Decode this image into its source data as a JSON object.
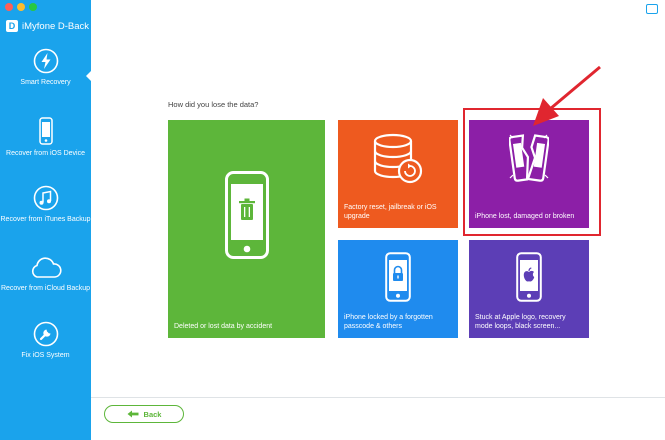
{
  "window": {
    "title": "iMyfone D-Back",
    "traffic_light_colors": [
      "#ff5f57",
      "#febc2e",
      "#28c840"
    ]
  },
  "sidebar": {
    "background": "#1aa3ec",
    "items": [
      {
        "label": "Smart Recovery",
        "icon": "lightning-icon",
        "active": true
      },
      {
        "label": "Recover from iOS Device",
        "icon": "iphone-icon",
        "active": false
      },
      {
        "label": "Recover from iTunes Backup",
        "icon": "music-note-icon",
        "active": false
      },
      {
        "label": "Recover from iCloud Backup",
        "icon": "cloud-icon",
        "active": false
      },
      {
        "label": "Fix iOS System",
        "icon": "wrench-icon",
        "active": false
      }
    ]
  },
  "main": {
    "question": "How did you lose the data?",
    "options": [
      {
        "label": "Deleted or lost data by accident",
        "icon": "phone-trash-icon",
        "color": "#5db63a"
      },
      {
        "label": "Factory reset, jailbreak or iOS upgrade",
        "icon": "database-reset-icon",
        "color": "#ee5a1f"
      },
      {
        "label": "iPhone lost, damaged or broken",
        "icon": "broken-phone-icon",
        "color": "#8c1fa7",
        "highlighted": true
      },
      {
        "label": "iPhone locked by a forgotten passcode & others",
        "icon": "phone-lock-icon",
        "color": "#1f8bee"
      },
      {
        "label": "Stuck at Apple logo, recovery mode loops, black screen...",
        "icon": "phone-apple-icon",
        "color": "#5c3eb6"
      }
    ],
    "highlight_color": "#e0262f"
  },
  "footer": {
    "back_label": "Back",
    "back_color": "#5db63a"
  }
}
